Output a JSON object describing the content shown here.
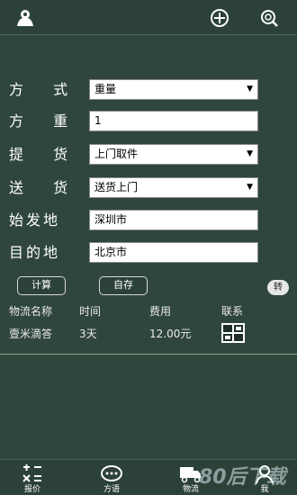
{
  "header": {
    "icons": [
      "person-icon",
      "add-circle-icon",
      "search-icon"
    ]
  },
  "form": {
    "method": {
      "label": "方 式",
      "value": "重量"
    },
    "weight": {
      "label": "方 重",
      "value": "1"
    },
    "pickup": {
      "label": "提 货",
      "value": "上门取件"
    },
    "delivery": {
      "label": "送 货",
      "value": "送货上门"
    },
    "origin": {
      "label": "始发地",
      "value": "深圳市"
    },
    "destination": {
      "label": "目的地",
      "value": "北京市"
    }
  },
  "buttons": {
    "calculate": "计算",
    "self_deposit": "自存",
    "convert": "转"
  },
  "table": {
    "headers": [
      "物流名称",
      "时间",
      "费用",
      "联系"
    ],
    "rows": [
      {
        "name": "壹米滴答",
        "time": "3天",
        "cost": "12.00元",
        "contact_icon": "qr-code-icon"
      }
    ]
  },
  "bottom_nav": [
    {
      "label": "报价",
      "icon": "calculator-icon"
    },
    {
      "label": "方语",
      "icon": "chat-bubble-icon"
    },
    {
      "label": "物流",
      "icon": "truck-icon"
    },
    {
      "label": "我",
      "icon": "user-icon"
    }
  ],
  "watermark": "80后下载"
}
